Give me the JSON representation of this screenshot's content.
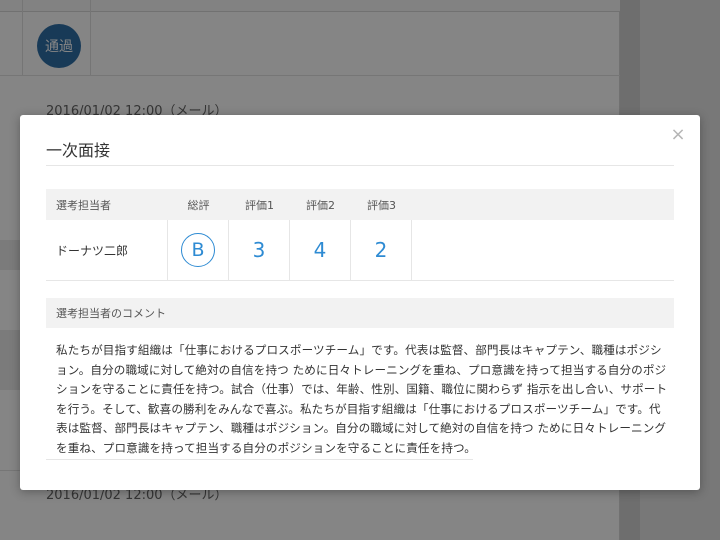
{
  "background": {
    "status_badge": "通過",
    "date_top": "2016/01/02  12:00（メール）",
    "date_bottom": "2016/01/02  12:00（メール）"
  },
  "modal": {
    "title": "一次面接",
    "close_label": "×",
    "table": {
      "headers": {
        "selector": "選考担当者",
        "total": "総評",
        "score1": "評価1",
        "score2": "評価2",
        "score3": "評価3"
      },
      "row": {
        "selector": "ドーナツ二郎",
        "total": "B",
        "score1": "3",
        "score2": "4",
        "score3": "2"
      }
    },
    "comment": {
      "header": "選考担当者のコメント",
      "text": "私たちが目指す組織は「仕事におけるプロスポーツチーム」です。代表は監督、部門長はキャプテン、職種はポジション。自分の職域に対して絶対の自信を持つ ために日々トレーニングを重ね、プロ意識を持って担当する自分のポジションを守ることに責任を持つ。試合（仕事）では、年齢、性別、国籍、職位に関わらず 指示を出し合い、サポートを行う。そして、歓喜の勝利をみんなで喜ぶ。私たちが目指す組織は「仕事におけるプロスポーツチーム」です。代表は監督、部門長はキャプテン、職種はポジション。自分の職域に対して絶対の自信を持つ ために日々トレーニングを重ね、プロ意識を持って担当する自分のポジションを守ることに責任を持つ。"
    }
  },
  "colors": {
    "accent": "#2e8bd3",
    "badge": "#2f6fa8"
  }
}
